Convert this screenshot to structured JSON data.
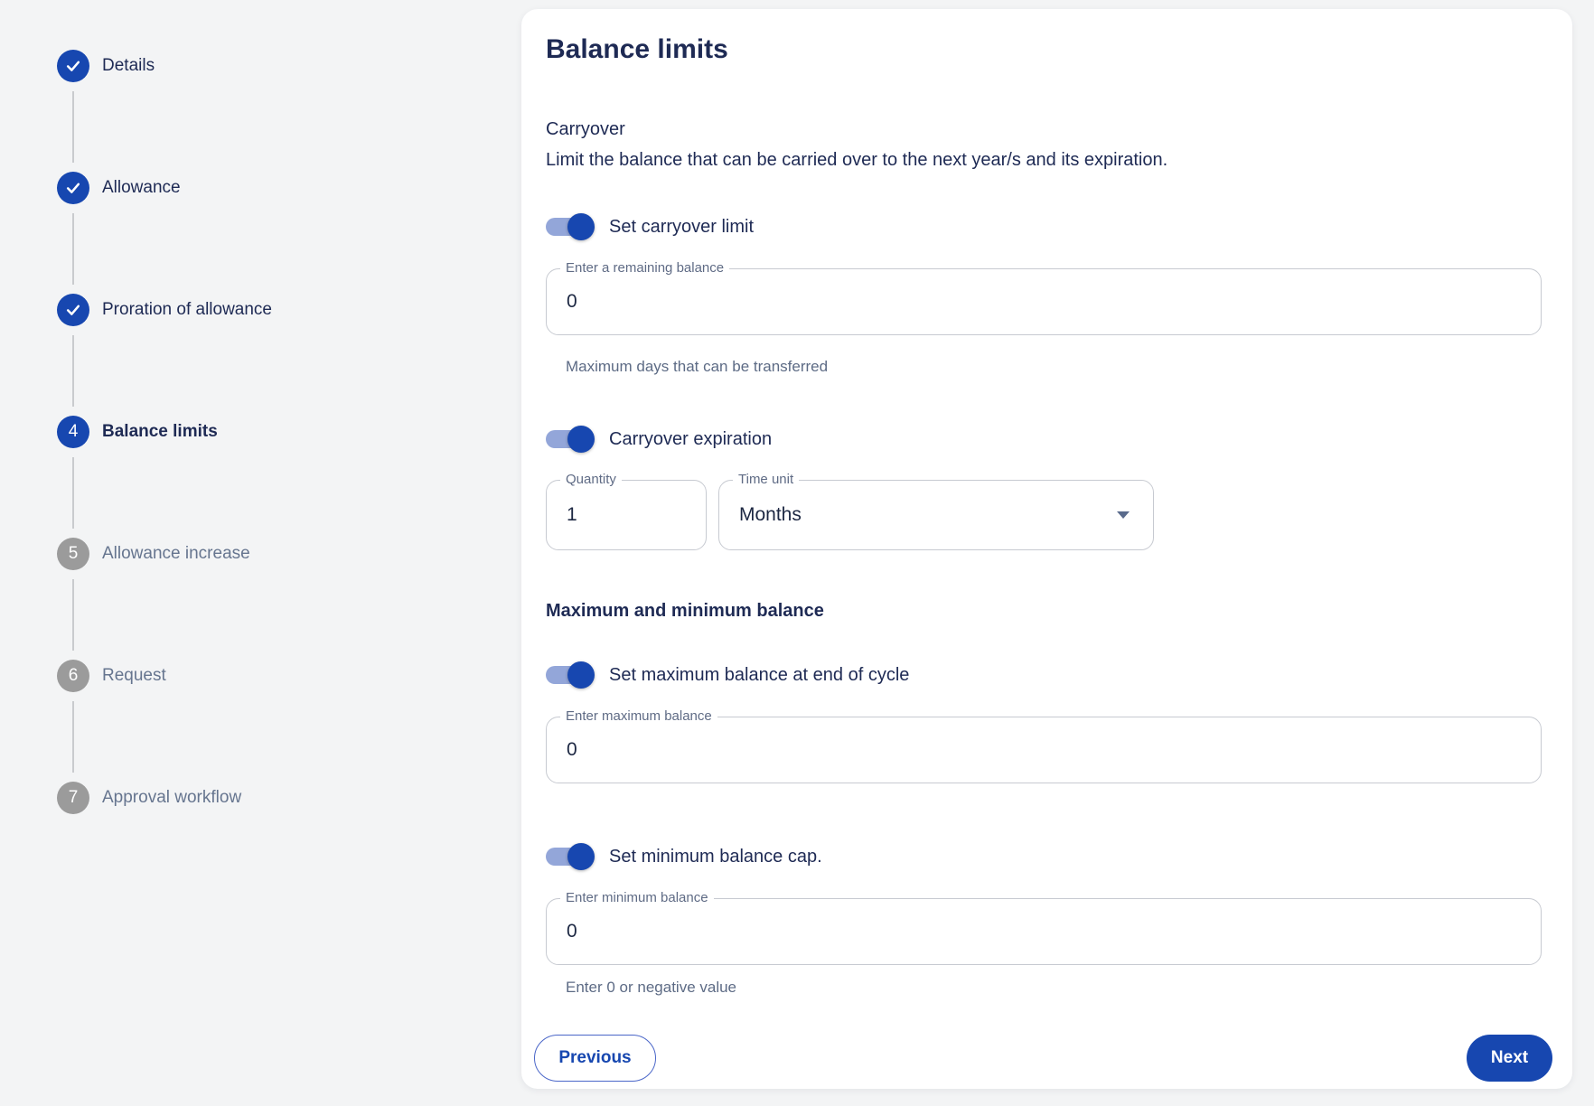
{
  "colors": {
    "primary_blue": "#1747B0",
    "toggle_track_blue": "#93A6D9",
    "inactive_step_gray": "#9B9B9B",
    "navy_text": "#1E2A54",
    "muted_text": "#66758F",
    "helper_text": "#5D6B85",
    "input_border": "#C7CAD1",
    "page_background": "#F3F4F5",
    "card_background": "#FFFFFF"
  },
  "icons": {
    "completed_step_icon": "check",
    "time_unit_dropdown_icon": "caret-down"
  },
  "stepper": {
    "steps": [
      {
        "label": "Details",
        "state": "completed"
      },
      {
        "label": "Allowance",
        "state": "completed"
      },
      {
        "label": "Proration of allowance",
        "state": "completed"
      },
      {
        "label": "Balance limits",
        "state": "active",
        "number": "4"
      },
      {
        "label": "Allowance increase",
        "state": "upcoming",
        "number": "5"
      },
      {
        "label": "Request",
        "state": "upcoming",
        "number": "6"
      },
      {
        "label": "Approval workflow",
        "state": "upcoming",
        "number": "7"
      }
    ]
  },
  "panel": {
    "title": "Balance limits",
    "carryover": {
      "heading": "Carryover",
      "description": "Limit the balance that can be carried over to the next year/s and its expiration.",
      "limit_toggle": {
        "label": "Set carryover limit",
        "on": true
      },
      "remaining_balance_field": {
        "label": "Enter a remaining balance",
        "value": "0",
        "helper": "Maximum days that can be transferred"
      },
      "expiration_toggle": {
        "label": "Carryover expiration",
        "on": true
      },
      "quantity_field": {
        "label": "Quantity",
        "value": "1"
      },
      "time_unit_select": {
        "label": "Time unit",
        "value": "Months"
      }
    },
    "balance_caps": {
      "heading": "Maximum and minimum balance",
      "max_toggle": {
        "label": "Set maximum balance at end of cycle",
        "on": true
      },
      "max_field": {
        "label": "Enter maximum balance",
        "value": "0"
      },
      "min_toggle": {
        "label": "Set minimum balance cap.",
        "on": true
      },
      "min_field": {
        "label": "Enter minimum balance",
        "value": "0",
        "helper": "Enter 0 or negative value"
      }
    },
    "footer": {
      "previous_label": "Previous",
      "next_label": "Next"
    }
  }
}
